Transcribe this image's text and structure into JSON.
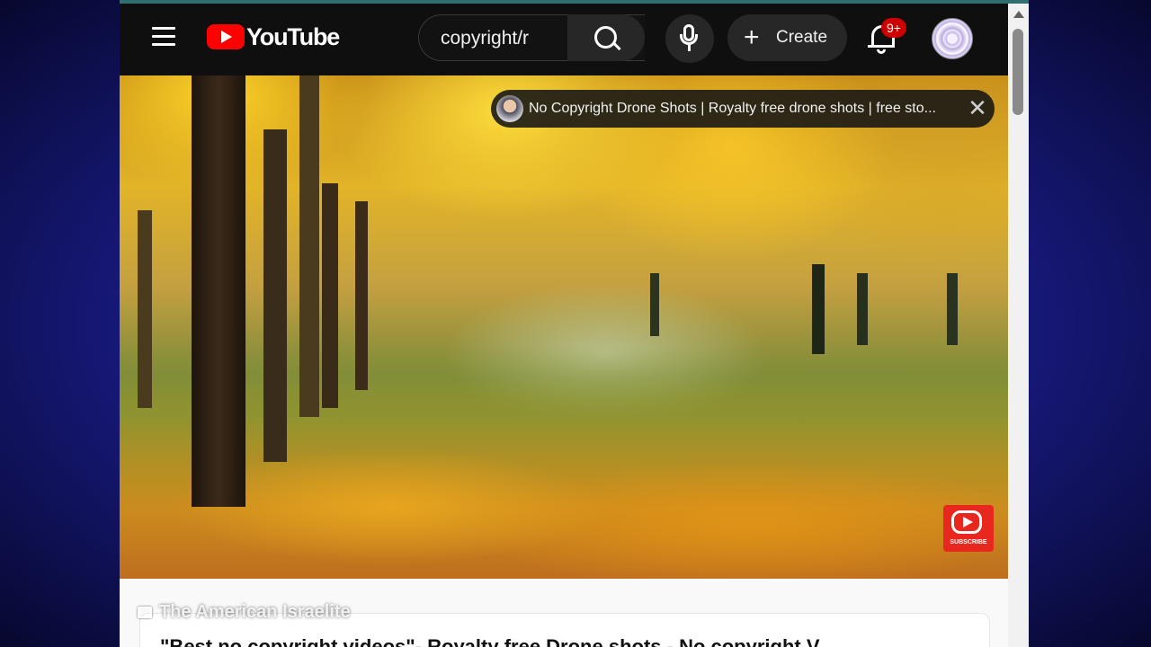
{
  "header": {
    "logo_text": "YouTube",
    "search_value": "copyright/r",
    "create_label": "Create",
    "notification_badge": "9+"
  },
  "player": {
    "notification_text": "No Copyright Drone Shots | Royalty free drone shots | free sto...",
    "close_glyph": "✕",
    "subscribe_text": "SUBSCRIBE"
  },
  "below": {
    "watermark": "The American Israelite",
    "video_title": "\"Best no copyright videos\"- Royalty free Drone shots - No copyright V"
  },
  "colors": {
    "brand_red": "#ff0000",
    "header_bg": "#0f0f0f",
    "badge_red": "#cc0000"
  }
}
